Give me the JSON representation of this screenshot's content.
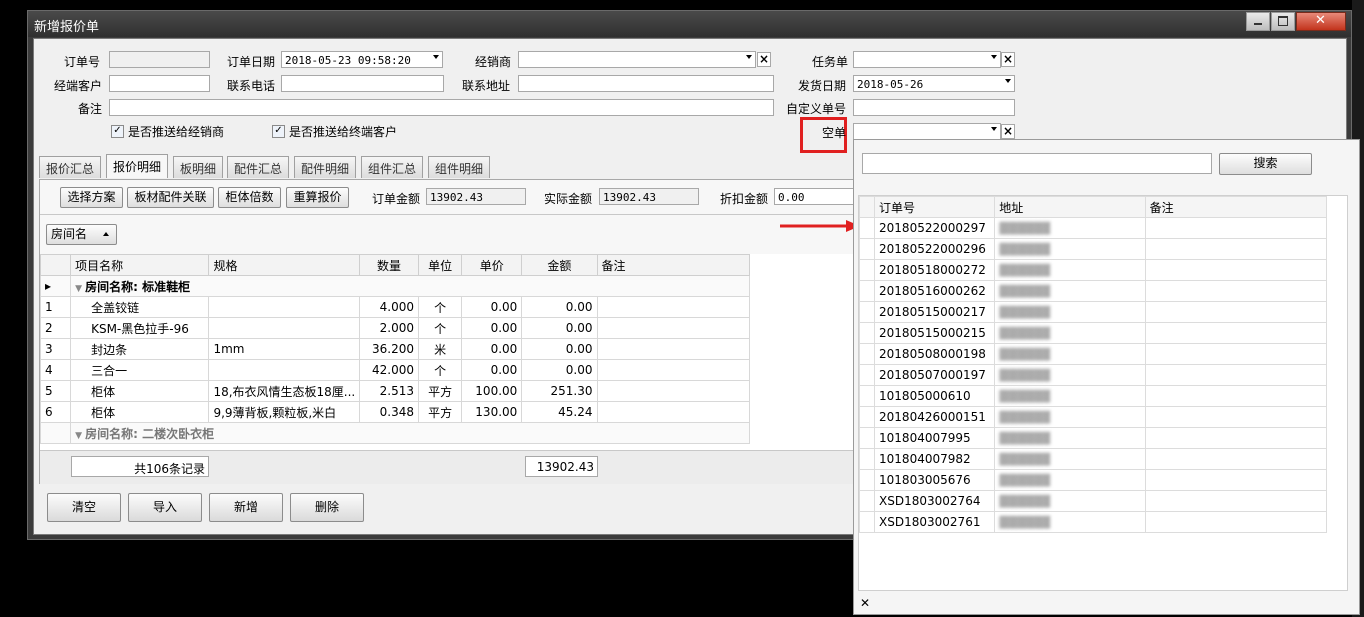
{
  "window": {
    "title": "新增报价单"
  },
  "form": {
    "order_no_label": "订单号",
    "order_no_value": "",
    "order_date_label": "订单日期",
    "order_date_value": "2018-05-23 09:58:20",
    "dealer_label": "经销商",
    "dealer_value": "",
    "task_label": "任务单",
    "task_value": "",
    "end_customer_label": "经端客户",
    "end_customer_value": "",
    "phone_label": "联系电话",
    "phone_value": "",
    "address_label": "联系地址",
    "address_value": "",
    "ship_date_label": "发货日期",
    "ship_date_value": "2018-05-26",
    "remark_label": "备注",
    "remark_value": "",
    "custom_no_label": "自定义单号",
    "custom_no_value": "",
    "empty_order_label": "空单",
    "empty_order_value": "",
    "push_dealer_label": "是否推送给经销商",
    "push_customer_label": "是否推送给终端客户"
  },
  "tabs": [
    "报价汇总",
    "报价明细",
    "板明细",
    "配件汇总",
    "配件明细",
    "组件汇总",
    "组件明细"
  ],
  "toolbar": {
    "select_plan": "选择方案",
    "board_link": "板材配件关联",
    "cabinet_mult": "柜体倍数",
    "recalc": "重算报价",
    "order_amount_label": "订单金额",
    "order_amount_value": "13902.43",
    "actual_amount_label": "实际金额",
    "actual_amount_value": "13902.43",
    "discount_label": "折扣金额",
    "discount_value": "0.00"
  },
  "group_by": "房间名",
  "grid": {
    "columns": [
      "项目名称",
      "规格",
      "数量",
      "单位",
      "单价",
      "金额",
      "备注"
    ],
    "group1": "房间名称: 标准鞋柜",
    "group2": "房间名称: 二楼次卧衣柜",
    "rows": [
      {
        "n": "1",
        "name": "全盖铰链",
        "spec": "",
        "qty": "4.000",
        "unit": "个",
        "price": "0.00",
        "amount": "0.00"
      },
      {
        "n": "2",
        "name": "KSM-黑色拉手-96",
        "spec": "",
        "qty": "2.000",
        "unit": "个",
        "price": "0.00",
        "amount": "0.00"
      },
      {
        "n": "3",
        "name": "封边条",
        "spec": "1mm",
        "qty": "36.200",
        "unit": "米",
        "price": "0.00",
        "amount": "0.00"
      },
      {
        "n": "4",
        "name": "三合一",
        "spec": "",
        "qty": "42.000",
        "unit": "个",
        "price": "0.00",
        "amount": "0.00"
      },
      {
        "n": "5",
        "name": "柜体",
        "spec": "18,布衣风情生态板18厘...",
        "qty": "2.513",
        "unit": "平方",
        "price": "100.00",
        "amount": "251.30"
      },
      {
        "n": "6",
        "name": "柜体",
        "spec": "9,9薄背板,颗粒板,米白",
        "qty": "0.348",
        "unit": "平方",
        "price": "130.00",
        "amount": "45.24"
      }
    ],
    "footer_count": "共106条记录",
    "footer_total": "13902.43"
  },
  "bottom_buttons": {
    "clear": "清空",
    "import": "导入",
    "add": "新增",
    "delete": "删除"
  },
  "popup": {
    "search_button": "搜索",
    "search_value": "",
    "columns": [
      "订单号",
      "地址",
      "备注"
    ],
    "rows": [
      {
        "order": "20180522000297"
      },
      {
        "order": "20180522000296"
      },
      {
        "order": "20180518000272"
      },
      {
        "order": "20180516000262"
      },
      {
        "order": "20180515000217"
      },
      {
        "order": "20180515000215"
      },
      {
        "order": "20180508000198"
      },
      {
        "order": "20180507000197"
      },
      {
        "order": "101805000610"
      },
      {
        "order": "20180426000151"
      },
      {
        "order": "101804007995"
      },
      {
        "order": "101804007982"
      },
      {
        "order": "101803005676"
      },
      {
        "order": "XSD1803002764"
      },
      {
        "order": "XSD1803002761"
      }
    ],
    "close_glyph": "✕"
  },
  "colors": {
    "highlight": "#e02020",
    "arrow": "#e02020"
  }
}
